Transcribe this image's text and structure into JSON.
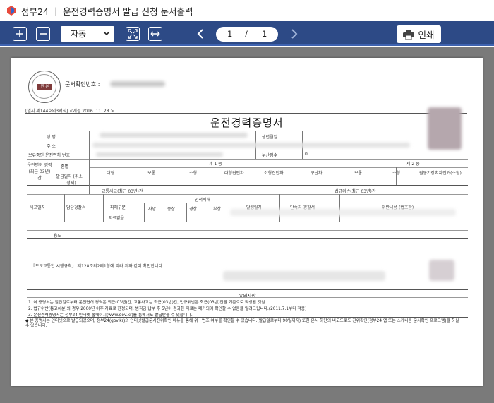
{
  "window": {
    "brand": "정부24",
    "title": "운전경력증명서 발급 신청 문서출력"
  },
  "toolbar": {
    "zoom_in_icon": "plus-square",
    "zoom_out_icon": "minus-square",
    "zoom_select_value": "자동",
    "fit_page_icon": "expand-arrows",
    "fit_width_icon": "horizontal-arrows",
    "current_page": "1",
    "page_separator": "/",
    "total_pages": "1",
    "print_label": "인쇄",
    "colors": {
      "bar": "#2d4a86",
      "accent": "#3f63b0"
    }
  },
  "document": {
    "doc_number_label": "문서확인번호 :",
    "form_header": "[별지 제144호의3서식] <개정 2016. 11. 28.>",
    "title": "운전경력증명서",
    "stamp_text": "진 본",
    "fields": {
      "name": "성        명",
      "birthdate": "생년월일",
      "address": "주        소",
      "license_no": "보유중인 운전면허 번호",
      "penalty_points": "누산점수",
      "penalty_points_value": "0",
      "license_section": "운전면허 경력 (최근 03년)간",
      "type": "종별",
      "issue_date": "발급일자 (취소ㆍ정지)",
      "class1": "제 1 종",
      "class2": "제 2 종",
      "class1_types": [
        "대형",
        "보통",
        "소형",
        "대형견인차",
        "소형견인차",
        "구난차"
      ],
      "class2_types": [
        "보통",
        "소형",
        "원동기장치자전거(소형)"
      ]
    },
    "accidents": {
      "section": "교통사고(최근 03년)간",
      "date": "사고일자",
      "station": "담당경찰서",
      "victim_type": "피해구분",
      "injury_header": "인적피해",
      "injury_types": [
        "사망",
        "중상",
        "경상",
        "부상"
      ],
      "property": "자료없음"
    },
    "violations": {
      "section": "법규위반(최근 03년)간",
      "date": "발생일자",
      "station": "단속지 경찰서",
      "details": "위반내용 (법조항)"
    },
    "purpose": "용도",
    "law_ref": "『도로교통법 시행규칙』 제128조의2제1항에 따라 위와 같이 확인합니다.",
    "notice": {
      "title": "유의사항",
      "lines": [
        "1. 이 증명서는 발급일로부터 운전면허 경력은 최근(03년)간, 교통사고는 최근(03년)간, 법규위반은 최근(03년)간을 기준으로 작성된 것임.",
        "2. 법규위반(통고처분)의 경우 2000년 이후 자료로 한정되며, 범칙금 납부 후 5년이 경과한 자료는 폐기되어 확인할 수 없음을 알려드립니다.(2011.7.1부터 적용)",
        "3. 운전경력증명서는 정부24 인터넷 홈페이지(www.gov.kr)를 통해서도 발급받을 수 있습니다.",
        "◆ 본 증명서는 인터넷으로 발급되었으며, 정부24(gov.kr)의 인터넷발급문서진위확인 메뉴를 통해 위ㆍ변조 여부를 확인할 수 있습니다.(발급일로부터 90일까지) 또한 문서 하단의 바코드로도 진위확인(정부24 앱 또는 스캐너용 문서확인 프로그램)을 하실 수 있습니다."
      ]
    }
  }
}
